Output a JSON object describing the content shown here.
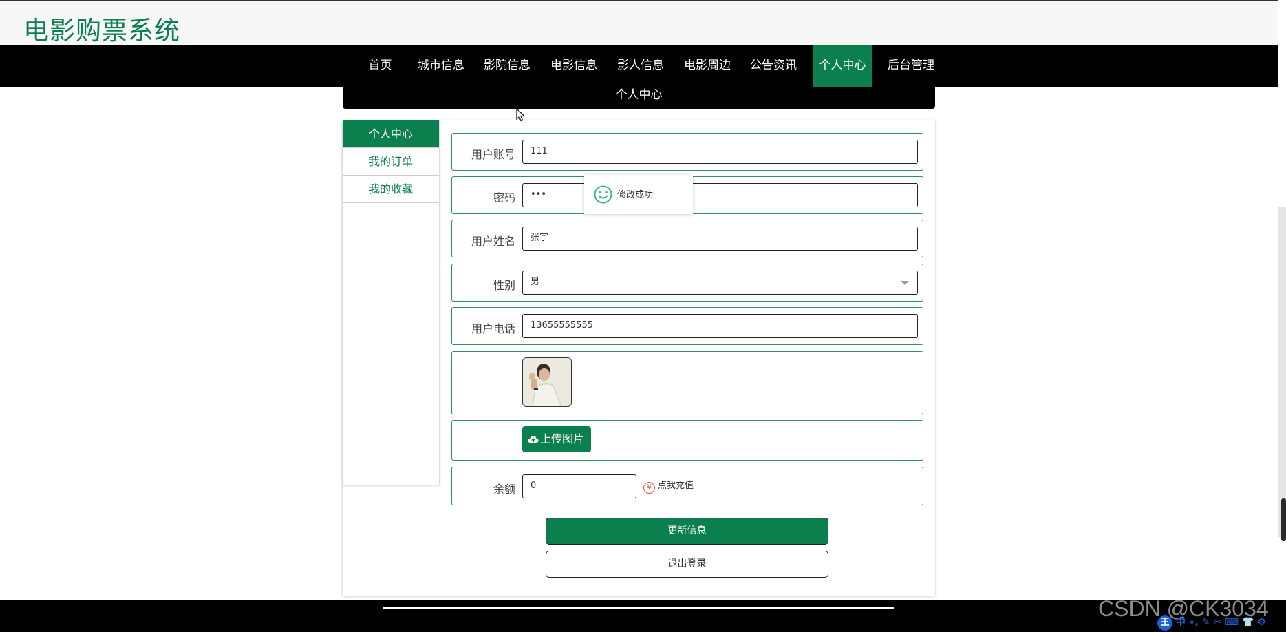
{
  "header": {
    "brand": "电影购票系统"
  },
  "nav": {
    "items": [
      {
        "label": "首页"
      },
      {
        "label": "城市信息"
      },
      {
        "label": "影院信息"
      },
      {
        "label": "电影信息"
      },
      {
        "label": "影人信息"
      },
      {
        "label": "电影周边"
      },
      {
        "label": "公告资讯"
      },
      {
        "label": "个人中心",
        "active": true
      },
      {
        "label": "后台管理"
      }
    ]
  },
  "breadcrumb": {
    "title": "个人中心"
  },
  "sidebar": {
    "items": [
      {
        "label": "个人中心",
        "active": true
      },
      {
        "label": "我的订单"
      },
      {
        "label": "我的收藏"
      }
    ]
  },
  "form": {
    "account_label": "用户账号",
    "account_value": "111",
    "password_label": "密码",
    "password_value": "•••",
    "name_label": "用户姓名",
    "name_value": "张宇",
    "gender_label": "性别",
    "gender_value": "男",
    "phone_label": "用户电话",
    "phone_value": "13655555555",
    "upload_label": "上传图片",
    "balance_label": "余额",
    "balance_value": "0",
    "recharge_label": "点我充值",
    "recharge_symbol": "¥",
    "update_label": "更新信息",
    "logout_label": "退出登录"
  },
  "toast": {
    "message": "修改成功"
  },
  "watermark": {
    "text": "CSDN @CK3034"
  },
  "ime": {
    "logo": "王",
    "text": "中 ∘, ✎ ✂ ⌨ 👕 ⚙"
  },
  "colors": {
    "primary": "#0b7f4e",
    "nav_bg": "#000000",
    "border": "#2f8f5f"
  },
  "icons": [
    "smile-icon",
    "cloud-upload-icon",
    "yen-icon",
    "chevron-down-icon",
    "mouse-cursor-icon"
  ]
}
